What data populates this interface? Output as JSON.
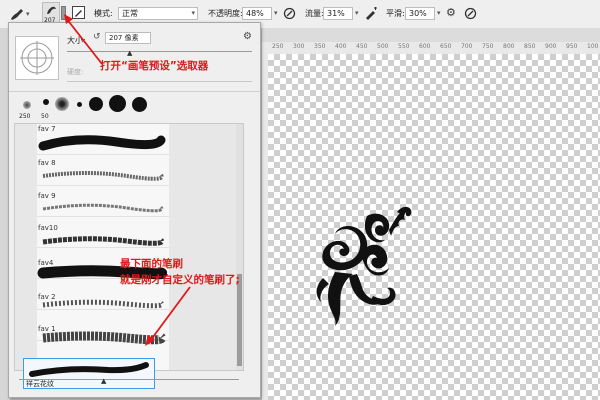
{
  "options_bar": {
    "brush_size": "207",
    "mode_label": "模式:",
    "mode_value": "正常",
    "opacity_label": "不透明度:",
    "opacity_value": "48%",
    "flow_label": "流量:",
    "flow_value": "31%",
    "smoothing_label": "平滑:",
    "smoothing_value": "30%"
  },
  "picker": {
    "size_label": "大小:",
    "size_value": "207 像素",
    "hardness_label": "硬度:",
    "tip_sizes": [
      "250",
      "50"
    ],
    "presets": [
      {
        "label": "fav 7"
      },
      {
        "label": "fav 8"
      },
      {
        "label": "fav 9"
      },
      {
        "label": "fav10"
      },
      {
        "label": "fav4"
      },
      {
        "label": "fav 2"
      },
      {
        "label": "fav 1"
      }
    ],
    "selected_preset": "祥云花纹"
  },
  "ruler": {
    "ticks": [
      "250",
      "300",
      "350",
      "400",
      "450",
      "500",
      "550",
      "600",
      "650",
      "700",
      "750",
      "800",
      "850",
      "900",
      "950",
      "100"
    ]
  },
  "annotations": {
    "top_note": "打开“画笔预设”选取器",
    "bottom_line1": "最下面的笔刷",
    "bottom_line2": "就是刚才自定义的笔刷了;"
  },
  "colors": {
    "annotation": "#e01818",
    "selection": "#3d9be9"
  }
}
